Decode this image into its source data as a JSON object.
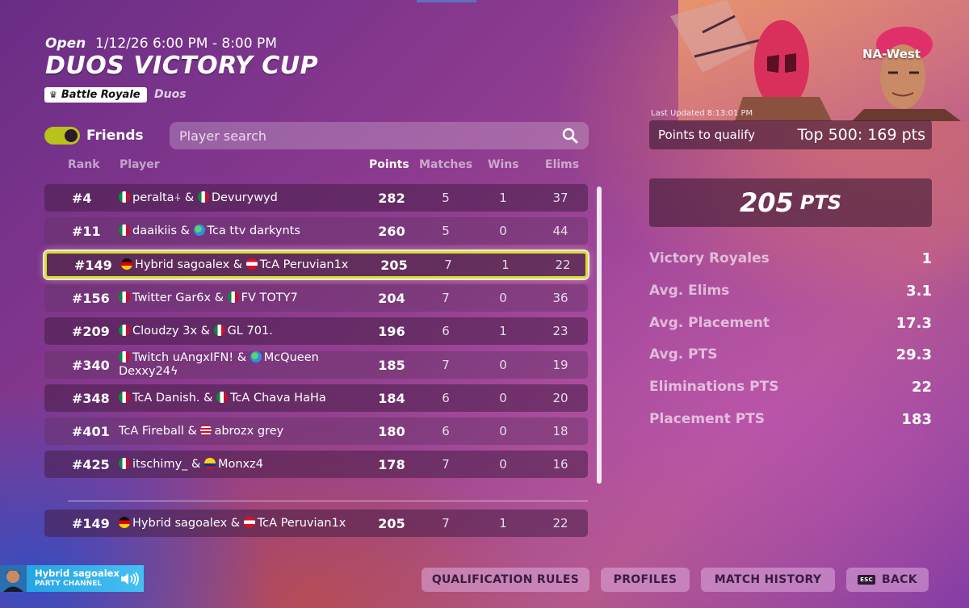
{
  "header": {
    "status": "Open",
    "time_window": "1/12/26 6:00 PM - 8:00 PM",
    "title": "DUOS VICTORY CUP",
    "mode_badge": "Battle Royale",
    "team_type": "Duos"
  },
  "filters": {
    "friends_label": "Friends",
    "friends_enabled": true,
    "search_placeholder": "Player search"
  },
  "table": {
    "columns": {
      "rank": "Rank",
      "player": "Player",
      "points": "Points",
      "matches": "Matches",
      "wins": "Wins",
      "elims": "Elims"
    },
    "rows": [
      {
        "rank": "#4",
        "flag1": "mx",
        "p1": "peralta⍭",
        "flag2": "mx",
        "p2": "Devurywyd",
        "points": "282",
        "matches": "5",
        "wins": "1",
        "elims": "37"
      },
      {
        "rank": "#11",
        "flag1": "mx",
        "p1": "daaikiis",
        "flag2": "globe",
        "p2": "Tca ttv darkynts",
        "points": "260",
        "matches": "5",
        "wins": "0",
        "elims": "44"
      },
      {
        "rank": "#149",
        "flag1": "de",
        "p1": "Hybrid sagoalex",
        "flag2": "pe",
        "p2": "TcA Peruvian1x",
        "points": "205",
        "matches": "7",
        "wins": "1",
        "elims": "22",
        "highlighted": true
      },
      {
        "rank": "#156",
        "flag1": "mx",
        "p1": "Twitter Gar6x",
        "flag2": "mx",
        "p2": "FV TOTY7",
        "points": "204",
        "matches": "7",
        "wins": "0",
        "elims": "36"
      },
      {
        "rank": "#209",
        "flag1": "mx",
        "p1": "Cloudzy 3x",
        "flag2": "mx",
        "p2": "GL 701.",
        "points": "196",
        "matches": "6",
        "wins": "1",
        "elims": "23"
      },
      {
        "rank": "#340",
        "flag1": "mx",
        "p1": "Twitch uAngxIFN!",
        "flag2": "globe",
        "p2": "McQueen Dexxy24ϟ",
        "points": "185",
        "matches": "7",
        "wins": "0",
        "elims": "19"
      },
      {
        "rank": "#348",
        "flag1": "mx",
        "p1": "TcA Danish.",
        "flag2": "mx",
        "p2": "TcA Chava HaHa",
        "points": "184",
        "matches": "6",
        "wins": "0",
        "elims": "20"
      },
      {
        "rank": "#401",
        "flag1": "",
        "p1": "TcA Fireball",
        "flag2": "us",
        "p2": "abrozx grey",
        "points": "180",
        "matches": "6",
        "wins": "0",
        "elims": "18"
      },
      {
        "rank": "#425",
        "flag1": "mx",
        "p1": "itschimy_",
        "flag2": "co",
        "p2": "Monxz4",
        "points": "178",
        "matches": "7",
        "wins": "0",
        "elims": "16"
      }
    ],
    "pinned": {
      "rank": "#149",
      "flag1": "de",
      "p1": "Hybrid sagoalex",
      "flag2": "pe",
      "p2": "TcA Peruvian1x",
      "points": "205",
      "matches": "7",
      "wins": "1",
      "elims": "22"
    }
  },
  "summary": {
    "region": "NA-West",
    "last_updated": "Last Updated 8:13:01 PM",
    "qualify_label": "Points to qualify",
    "qualify_value": "Top 500: 169 pts",
    "total_points": "205",
    "total_unit": "PTS",
    "stats": [
      {
        "label": "Victory Royales",
        "value": "1"
      },
      {
        "label": "Avg. Elims",
        "value": "3.1"
      },
      {
        "label": "Avg. Placement",
        "value": "17.3"
      },
      {
        "label": "Avg. PTS",
        "value": "29.3"
      },
      {
        "label": "Eliminations PTS",
        "value": "22"
      },
      {
        "label": "Placement PTS",
        "value": "183"
      }
    ]
  },
  "party": {
    "name": "Hybrid sagoalex",
    "channel": "PARTY CHANNEL"
  },
  "buttons": {
    "qualification_rules": "QUALIFICATION RULES",
    "profiles": "PROFILES",
    "match_history": "MATCH HISTORY",
    "back_key": "ESC",
    "back": "BACK"
  },
  "colors": {
    "highlight": "#d7e02b",
    "toggle_on": "#b7c21a",
    "party_bar": "#1f9ee0"
  }
}
